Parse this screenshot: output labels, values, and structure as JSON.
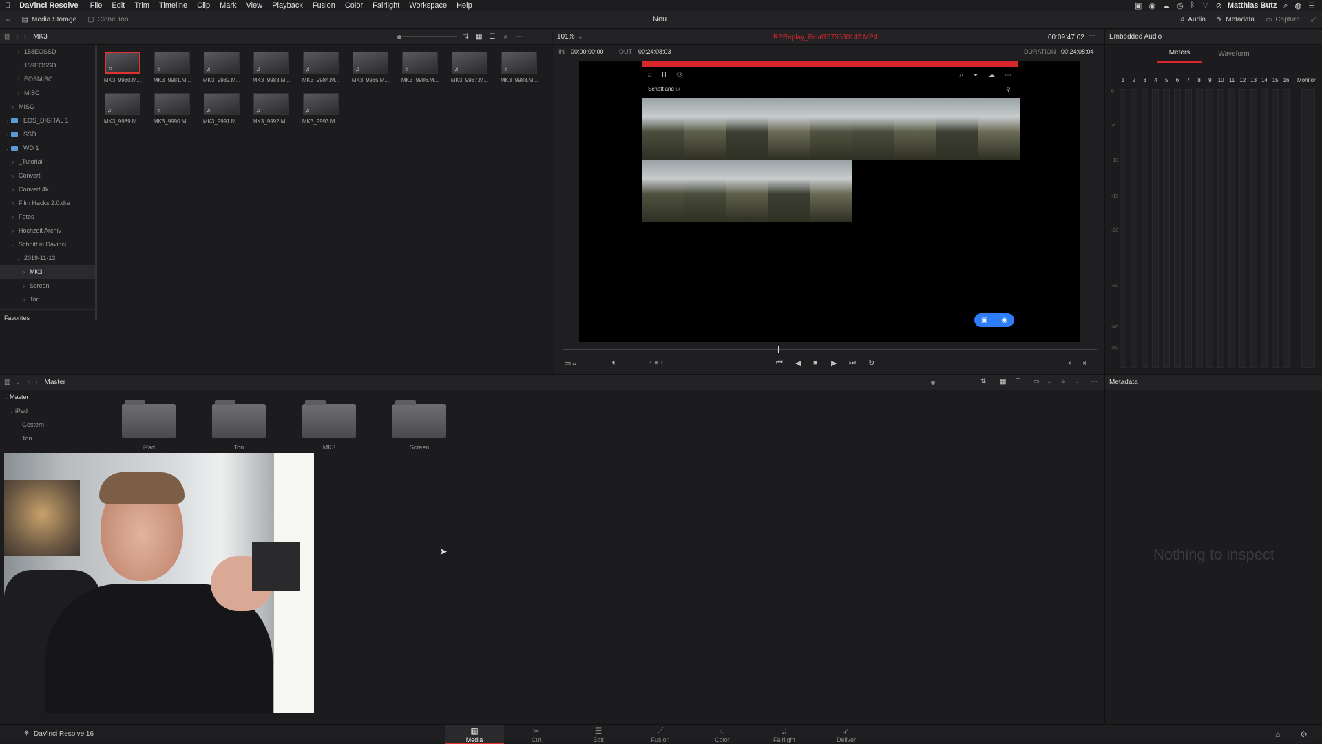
{
  "menubar": {
    "app": "DaVinci Resolve",
    "items": [
      "File",
      "Edit",
      "Trim",
      "Timeline",
      "Clip",
      "Mark",
      "View",
      "Playback",
      "Fusion",
      "Color",
      "Fairlight",
      "Workspace",
      "Help"
    ],
    "user": "Matthias Butz"
  },
  "toolbar": {
    "media_storage": "Media Storage",
    "clone_tool": "Clone Tool",
    "project": "Neu",
    "audio": "Audio",
    "metadata": "Metadata",
    "capture": "Capture"
  },
  "media_storage": {
    "path": "MK3",
    "items": [
      {
        "label": "158EOSSD",
        "indent": 2,
        "chev": ">"
      },
      {
        "label": "159EOSSD",
        "indent": 2,
        "chev": ">"
      },
      {
        "label": "EOSMISC",
        "indent": 2,
        "chev": ">"
      },
      {
        "label": "MISC",
        "indent": 2,
        "chev": ">"
      },
      {
        "label": "MISC",
        "indent": 1,
        "chev": ">"
      },
      {
        "label": "EOS_DIGITAL 1",
        "indent": 0,
        "chev": ">",
        "drive": true
      },
      {
        "label": "SSD",
        "indent": 0,
        "chev": ">",
        "drive": true
      },
      {
        "label": "WD 1",
        "indent": 0,
        "chev": "v",
        "drive": true
      },
      {
        "label": "_Tutorial",
        "indent": 1,
        "chev": ">"
      },
      {
        "label": "Convert",
        "indent": 1,
        "chev": ">"
      },
      {
        "label": "Convert 4k",
        "indent": 1,
        "chev": ">"
      },
      {
        "label": "Film Hacks 2.0.dra",
        "indent": 1,
        "chev": ">"
      },
      {
        "label": "Fotos",
        "indent": 1,
        "chev": ">"
      },
      {
        "label": "Hochzeit Archiv",
        "indent": 1,
        "chev": ">"
      },
      {
        "label": "Schnitt in Davinci",
        "indent": 1,
        "chev": "v"
      },
      {
        "label": "2019-11-13",
        "indent": 2,
        "chev": "v"
      },
      {
        "label": "MK3",
        "indent": 3,
        "chev": ">",
        "selected": true
      },
      {
        "label": "Screen",
        "indent": 3,
        "chev": ">"
      },
      {
        "label": "Ton",
        "indent": 3,
        "chev": ">"
      }
    ],
    "favorites": "Favorites"
  },
  "clips": [
    "MK3_9980.M...",
    "MK3_9981.M...",
    "MK3_9982.M...",
    "MK3_9983.M...",
    "MK3_9984.M...",
    "MK3_9985.M...",
    "MK3_9986.M...",
    "MK3_9987.M...",
    "MK3_9988.M...",
    "MK3_9989.M...",
    "MK3_9990.M...",
    "MK3_9991.M...",
    "MK3_9992.M...",
    "MK3_9993.M..."
  ],
  "viewer": {
    "zoom": "101%",
    "clip_name": "RPReplay_Final1573560142.MP4",
    "timecode": "00:09:47:02",
    "in_label": "IN",
    "in": "00:00:00:00",
    "out_label": "OUT",
    "out": "00:24:08:03",
    "duration_label": "DURATION",
    "duration": "00:24:08:04",
    "album": "Schottland",
    "album_count": "14"
  },
  "audio_panel": {
    "title": "Embedded Audio",
    "tabs": [
      "Meters",
      "Waveform"
    ],
    "active_tab": "Meters",
    "channels": [
      "1",
      "2",
      "3",
      "4",
      "5",
      "6",
      "7",
      "8",
      "9",
      "10",
      "11",
      "12",
      "13",
      "14",
      "15",
      "16"
    ],
    "monitor": "Monitor",
    "scale": [
      "0",
      "-5",
      "-10",
      "-15",
      "-20",
      "-30",
      "-40",
      "-50"
    ]
  },
  "media_pool": {
    "title": "Master",
    "tree": [
      {
        "label": "Master",
        "chev": "v"
      },
      {
        "label": "iPad",
        "chev": "v"
      },
      {
        "label": "Gestern",
        "chev": ""
      },
      {
        "label": "Ton",
        "chev": ""
      }
    ],
    "folders": [
      "iPad",
      "Ton",
      "MK3",
      "Screen"
    ]
  },
  "metadata_panel": {
    "title": "Metadata",
    "empty": "Nothing to inspect"
  },
  "pages": [
    {
      "label": "Media",
      "icon": "▦"
    },
    {
      "label": "Cut",
      "icon": "✂"
    },
    {
      "label": "Edit",
      "icon": "☰"
    },
    {
      "label": "Fusion",
      "icon": "⟋"
    },
    {
      "label": "Color",
      "icon": "◌"
    },
    {
      "label": "Fairlight",
      "icon": "♫"
    },
    {
      "label": "Deliver",
      "icon": "➶"
    }
  ],
  "active_page": "Media",
  "footer": {
    "brand": "DaVinci Resolve 16"
  },
  "colors": {
    "accent_red": "#d7262c",
    "phone_blue": "#2d7df6"
  }
}
